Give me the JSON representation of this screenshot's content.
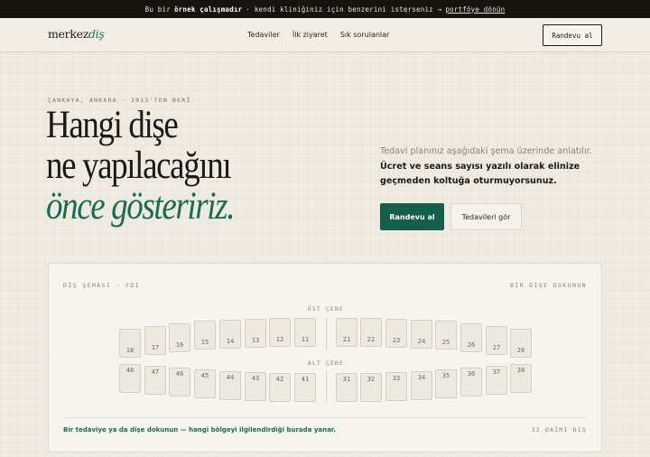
{
  "banner": {
    "prefix": "Bu bir",
    "bold": "örnek çalışmadır",
    "middle": "· kendi kliniğiniz için benzerini isterseniz →",
    "link": "portföye dönün"
  },
  "nav": {
    "logo_main": "merkez",
    "logo_accent": "diş",
    "links": [
      "Tedaviler",
      "İlk ziyaret",
      "Sık sorulanlar"
    ],
    "cta": "Randevu al"
  },
  "hero": {
    "eyebrow": "ÇANKAYA, ANKARA · 2013'TEN BERİ",
    "headline_line1": "Hangi dişe",
    "headline_line2": "ne yapılacağını",
    "headline_line3": "önce gösteririz.",
    "sub_muted": "Tedavi planınız aşağıdaki şema üzerinde anlatılır.",
    "sub_strong": "Ücret ve seans sayısı yazılı olarak elinize geçmeden koltuğa oturmuyorsunuz.",
    "primary_button": "Randevu al",
    "secondary_button": "Tedavileri gör"
  },
  "chart": {
    "label_left": "DİŞ ŞEMASI · FDI",
    "label_right": "BİR DİŞE DOKUNUN",
    "upper_label": "ÜST ÇENE",
    "lower_label": "ALT ÇENE",
    "upper_teeth": [
      "18",
      "17",
      "16",
      "15",
      "14",
      "13",
      "12",
      "11",
      "21",
      "22",
      "23",
      "24",
      "25",
      "26",
      "27",
      "28"
    ],
    "lower_teeth": [
      "48",
      "47",
      "46",
      "45",
      "44",
      "43",
      "42",
      "41",
      "31",
      "32",
      "33",
      "34",
      "35",
      "36",
      "37",
      "38"
    ],
    "footer_hint": "Bir tedaviye ya da dişe dokunun — hangi bölgeyi ilgilendirdiği burada yanar.",
    "footer_count": "32 DAİMİ DİŞ"
  }
}
